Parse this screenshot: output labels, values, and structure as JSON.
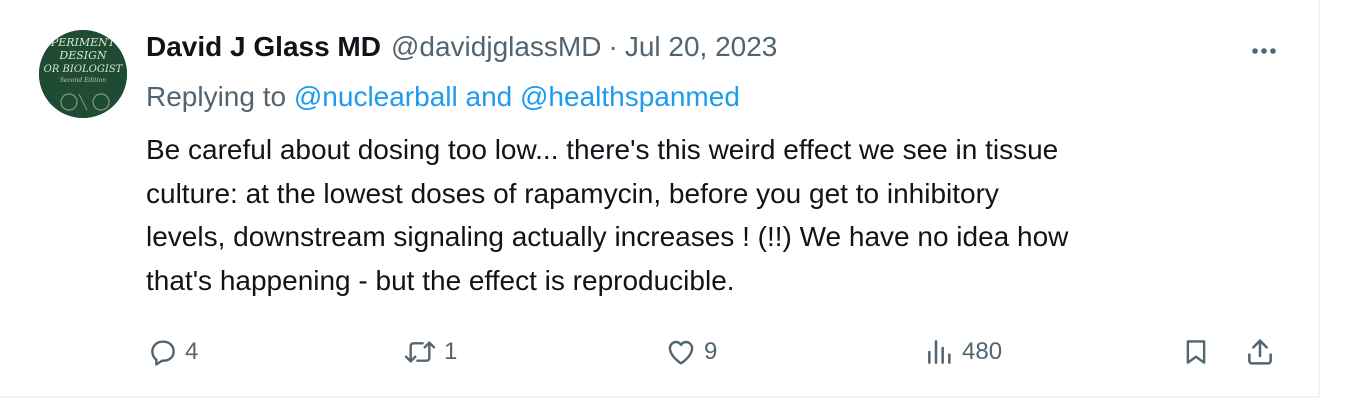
{
  "tweet": {
    "author_name": "David J Glass MD",
    "author_handle": "@davidjglassMD",
    "separator": "·",
    "date": "Jul 20, 2023",
    "replying_prefix": "Replying to",
    "mention_1": "@nuclearball",
    "mention_joiner": "and",
    "mention_2": "@healthspanmed",
    "body_lines": [
      "Be careful about dosing too low... there's this weird effect we see in tissue",
      "culture: at the lowest doses of rapamycin, before you get to inhibitory",
      "levels, downstream signaling actually increases ! (!!) We have no idea how",
      "that's happening - but the effect is reproducible."
    ],
    "avatar_text": [
      "PERIMENT",
      "DESIGN",
      "OR BIOLOGIST",
      "Second Edition"
    ]
  },
  "actions": {
    "replies": "4",
    "retweets": "1",
    "likes": "9",
    "views": "480"
  },
  "icons": {
    "more": "more-horizontal-icon",
    "reply": "reply-icon",
    "retweet": "retweet-icon",
    "like": "heart-icon",
    "views": "views-chart-icon",
    "bookmark": "bookmark-icon",
    "share": "share-icon"
  },
  "colors": {
    "text_primary": "#0f1419",
    "text_secondary": "#536471",
    "link": "#1d9bf0",
    "avatar_bg": "#1f4a34"
  }
}
